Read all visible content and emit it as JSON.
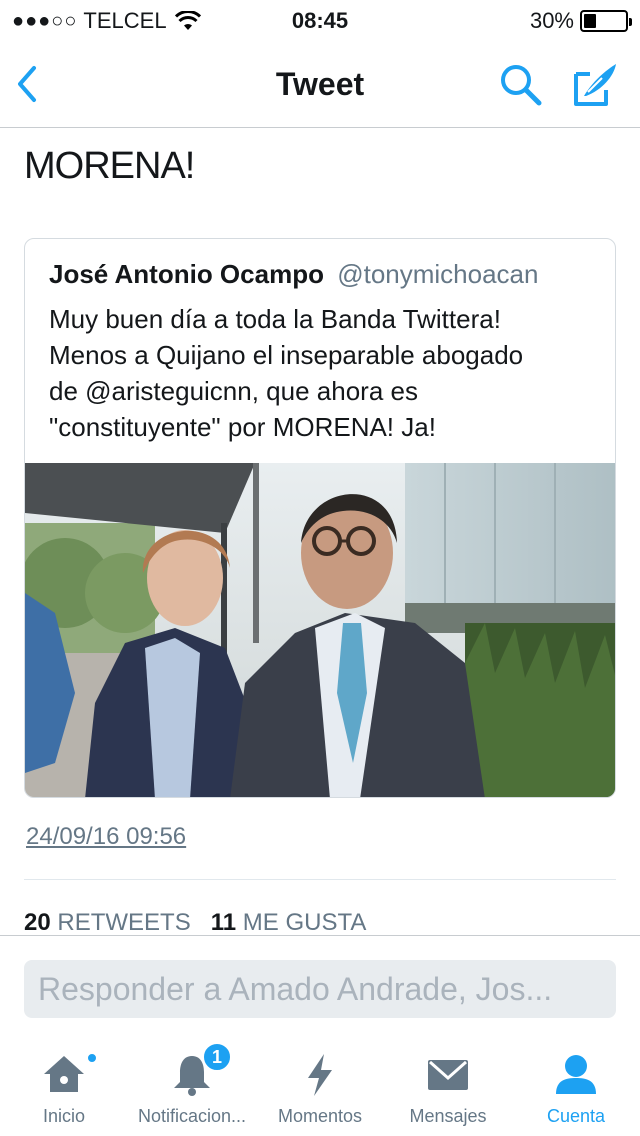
{
  "status_bar": {
    "signal": "●●●○○",
    "carrier": "TELCEL",
    "time": "08:45",
    "battery_text": "30%",
    "battery_level": 0.3
  },
  "nav": {
    "title": "Tweet",
    "icons": [
      "chevron-left-icon",
      "search-icon",
      "compose-icon"
    ],
    "accent_color": "#1da1f2"
  },
  "tweet": {
    "text_tail": "MORENA!",
    "quoted": {
      "name": "José Antonio Ocampo",
      "handle": "@tonymichoacan",
      "lines": [
        "Muy buen día a toda la Banda Twittera!",
        "Menos a Quijano el inseparable abogado",
        "de @aristeguicnn, que ahora es",
        "\"constituyente\" por MORENA! Ja!"
      ]
    },
    "timestamp": "24/09/16 09:56",
    "retweets_count": "20",
    "retweets_label": "RETWEETS",
    "likes_count": "11",
    "likes_label": "ME GUSTA"
  },
  "reply": {
    "placeholder": "Responder a Amado Andrade, Jos..."
  },
  "tabs": [
    {
      "label": "Inicio",
      "icon": "home-icon",
      "active": false,
      "dot": true
    },
    {
      "label": "Notificacion...",
      "icon": "bell-icon",
      "active": false,
      "badge": "1"
    },
    {
      "label": "Momentos",
      "icon": "lightning-icon",
      "active": false
    },
    {
      "label": "Mensajes",
      "icon": "envelope-icon",
      "active": false
    },
    {
      "label": "Cuenta",
      "icon": "person-icon",
      "active": true
    }
  ]
}
